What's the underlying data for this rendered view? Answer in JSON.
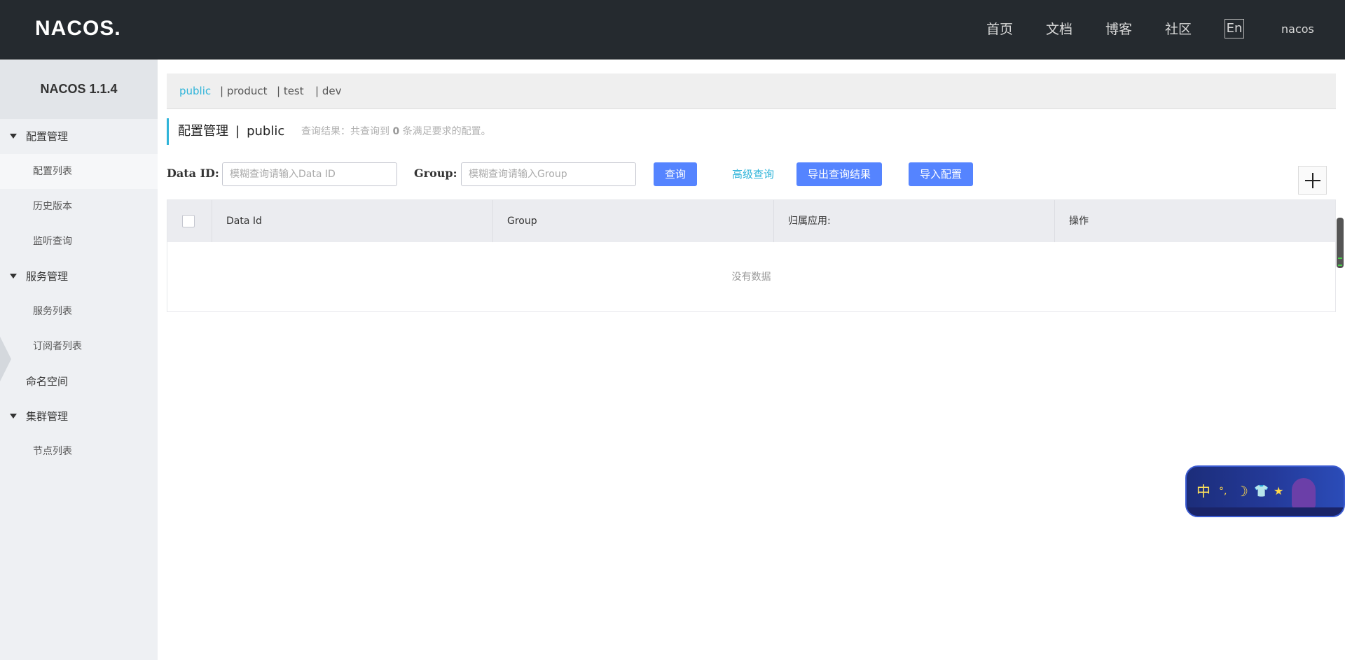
{
  "header": {
    "logo_text": "NACOS.",
    "nav": [
      "首页",
      "文档",
      "博客",
      "社区"
    ],
    "lang": "En",
    "user": "nacos"
  },
  "sidebar": {
    "product": "NACOS 1.1.4",
    "menu": [
      {
        "type": "group",
        "label": "配置管理"
      },
      {
        "type": "item",
        "label": "配置列表",
        "active": true
      },
      {
        "type": "item",
        "label": "历史版本"
      },
      {
        "type": "item",
        "label": "监听查询"
      },
      {
        "type": "group",
        "label": "服务管理"
      },
      {
        "type": "item",
        "label": "服务列表"
      },
      {
        "type": "item",
        "label": "订阅者列表"
      },
      {
        "type": "top",
        "label": "命名空间"
      },
      {
        "type": "group",
        "label": "集群管理"
      },
      {
        "type": "item",
        "label": "节点列表"
      }
    ]
  },
  "namespaces": {
    "active": "public",
    "others": [
      "| product",
      "| test",
      "| dev"
    ]
  },
  "title": {
    "main": "配置管理",
    "separator": "|",
    "namespace": "public",
    "result_prefix": "查询结果：共查询到",
    "result_count": "0",
    "result_suffix": "条满足要求的配置。"
  },
  "search": {
    "data_id_label": "Data ID:",
    "data_id_placeholder": "模糊查询请输入Data ID",
    "group_label": "Group:",
    "group_placeholder": "模糊查询请输入Group",
    "query_button": "查询",
    "advanced_link": "高级查询",
    "export_button": "导出查询结果",
    "import_button": "导入配置"
  },
  "table": {
    "columns": [
      "Data Id",
      "Group",
      "归属应用:",
      "操作"
    ],
    "empty_text": "没有数据"
  },
  "widget": {
    "glyphs": [
      "中",
      "°,",
      "☽",
      "👕",
      "★"
    ]
  },
  "colors": {
    "header_bg": "#252a2f",
    "sidebar_bg": "#eef0f3",
    "accent": "#2fb4d9",
    "primary_button": "#5584ff"
  }
}
